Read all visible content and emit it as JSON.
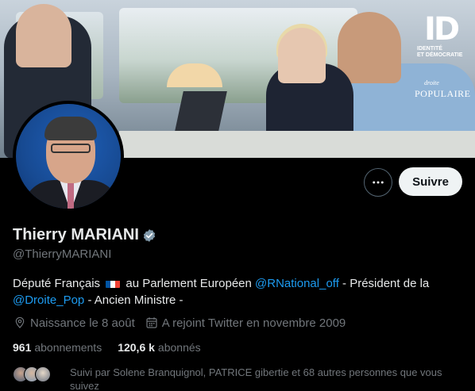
{
  "banner": {
    "logo_text_1": "IDENTITÉ",
    "logo_text_2": "ET DÉMOCRATIE",
    "brand_small": "droite",
    "brand_big": "POPULAIRE"
  },
  "actions": {
    "more_icon": "more-horizontal-icon",
    "follow_label": "Suivre"
  },
  "profile": {
    "name": "Thierry MARIANI",
    "handle": "@ThierryMARIANI",
    "bio_part1": "Député Français",
    "bio_part2": "au Parlement Européen",
    "bio_link1": "@RNational_off",
    "bio_part3": "- Président de la",
    "bio_link2": "@Droite_Pop",
    "bio_part4": "- Ancien Ministre -",
    "birthday": "Naissance le 8 août",
    "joined": "A rejoint Twitter en novembre 2009",
    "following_count": "961",
    "following_label": "abonnements",
    "followers_count": "120,6 k",
    "followers_label": "abonnés",
    "followed_by": "Suivi par Solene Branquignol, PATRICE gibertie et 68 autres personnes que vous suivez"
  },
  "colors": {
    "accent": "#1d9bf0",
    "background": "#000000",
    "muted": "#71767b",
    "verified": "#829aab"
  }
}
